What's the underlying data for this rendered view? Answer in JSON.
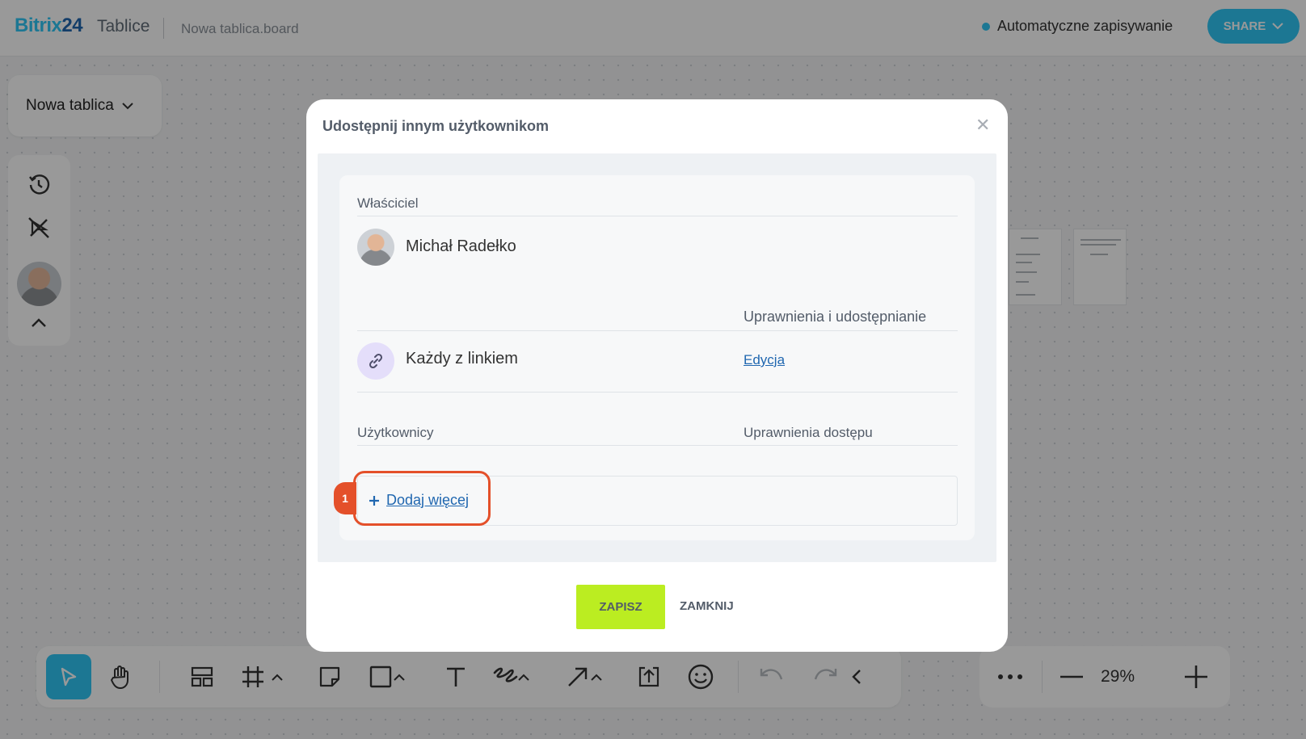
{
  "topbar": {
    "logo_text": "Bitrix",
    "logo_num": "24",
    "logo_sub": "Tablice",
    "board_file": "Nowa tablica.board",
    "autosave": "Automatyczne zapisywanie",
    "share": "SHARE"
  },
  "left": {
    "board_dropdown": "Nowa tablica"
  },
  "zoom": {
    "value": "29%"
  },
  "modal": {
    "title": "Udostępnij innym użytkownikom",
    "owner_label": "Właściciel",
    "owner_name": "Michał Radełko",
    "permissions_label": "Uprawnienia i udostępnianie",
    "link_name": "Każdy z linkiem",
    "link_permission": "Edycja",
    "users_label": "Użytkownicy",
    "access_label": "Uprawnienia dostępu",
    "add_more": "Dodaj więcej",
    "step": "1",
    "save": "ZAPISZ",
    "close": "ZAMKNIJ"
  },
  "colors": {
    "accent": "#2fc6f6",
    "brand": "#2067b0",
    "save": "#bbed21",
    "highlight": "#e4502a"
  }
}
